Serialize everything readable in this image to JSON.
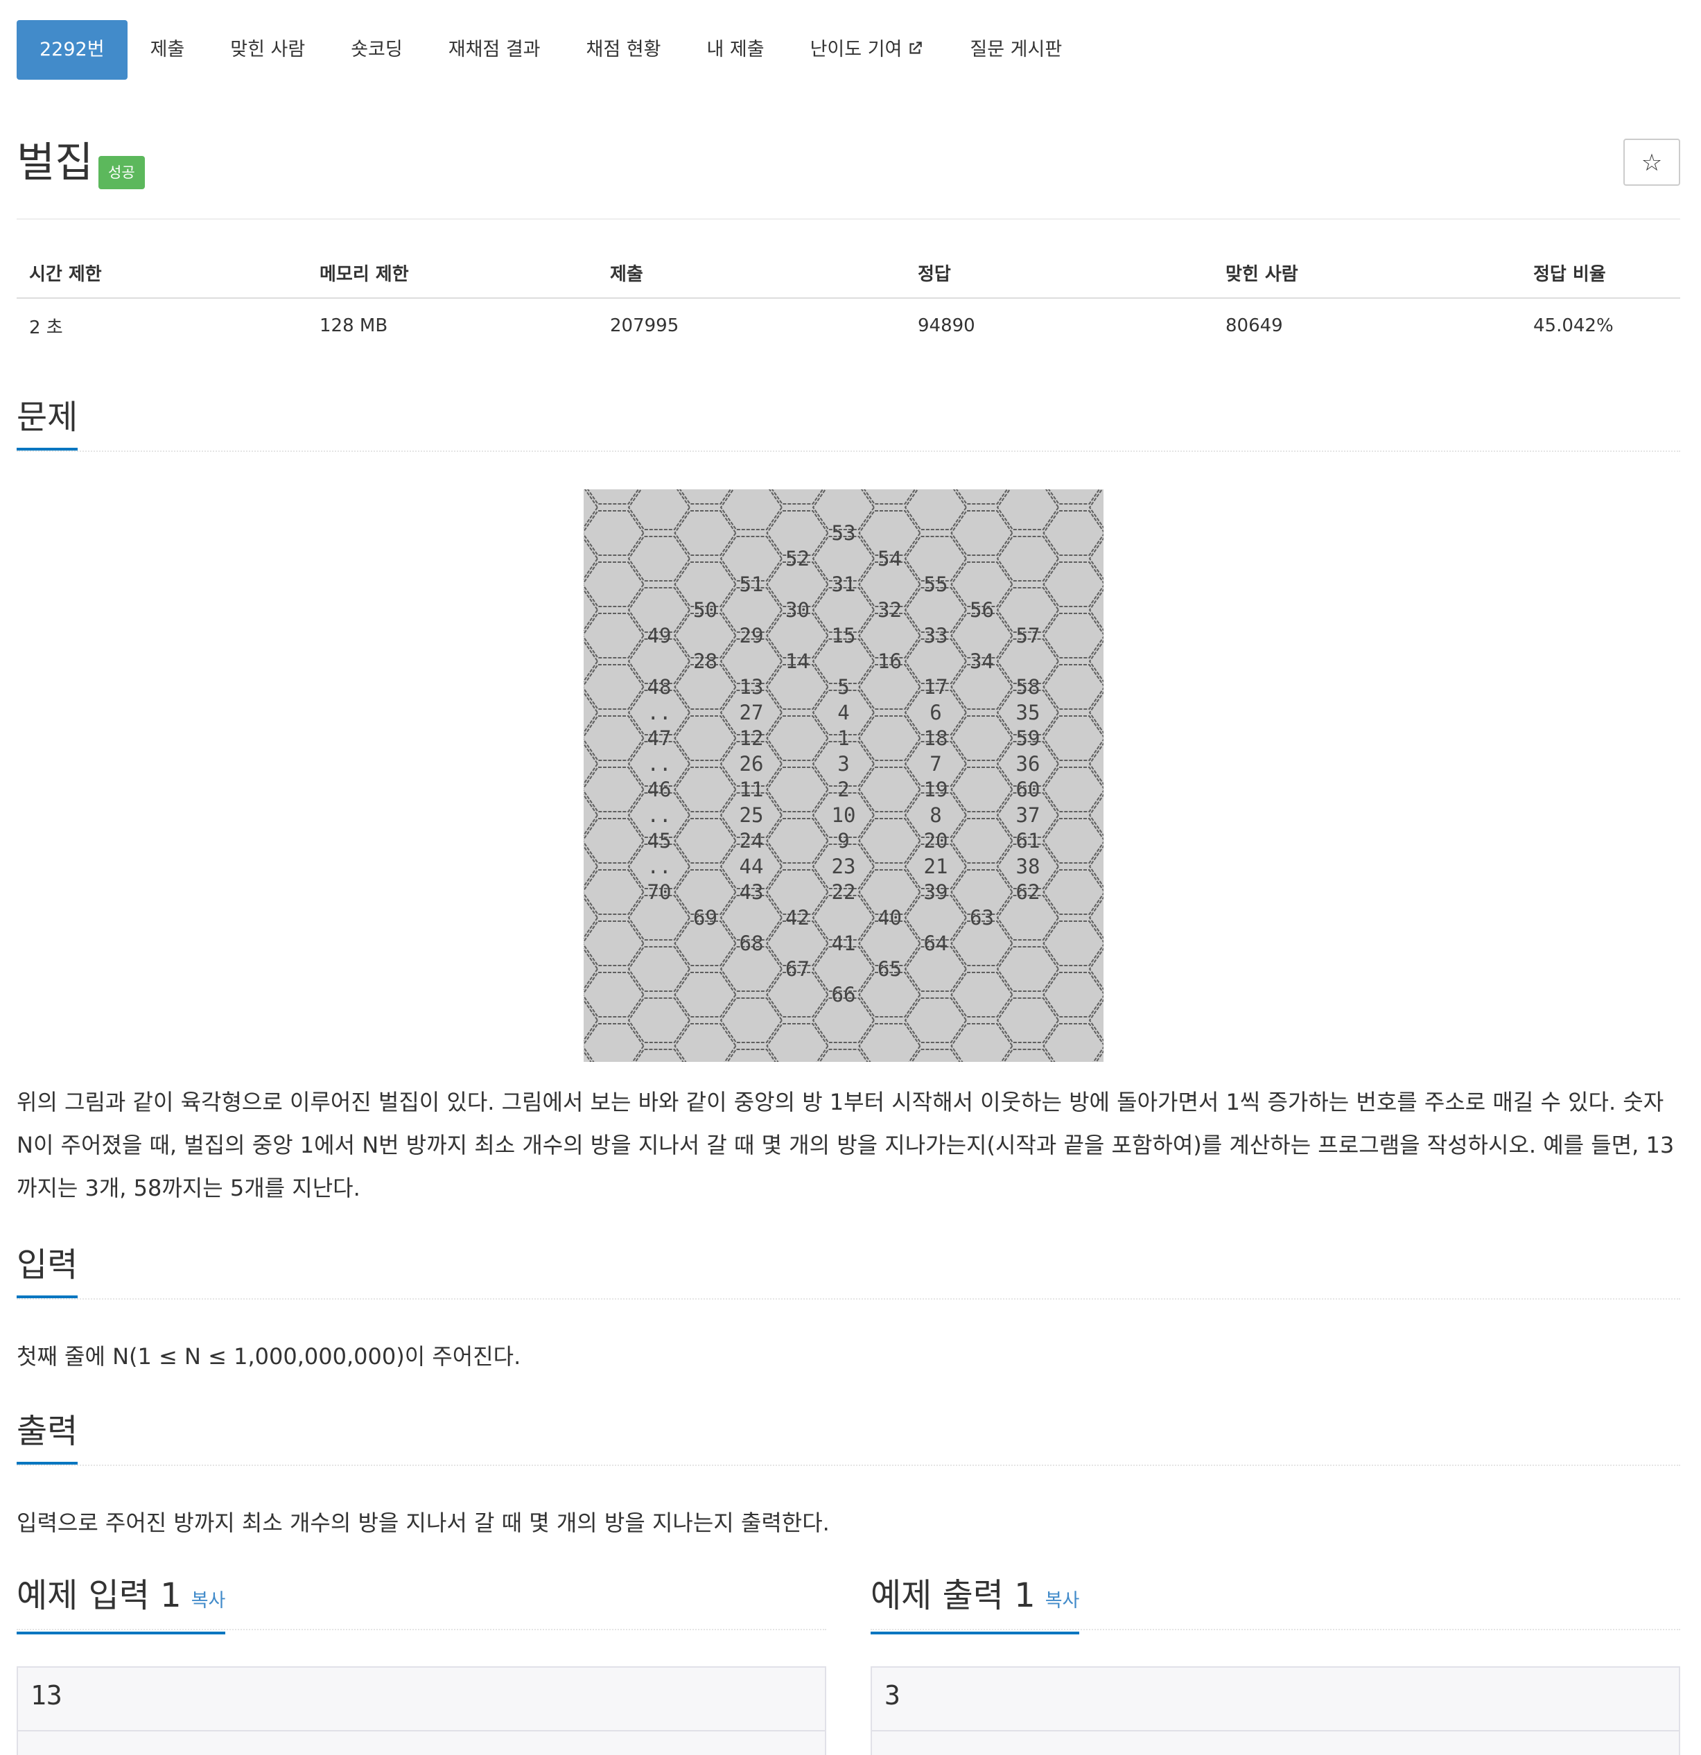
{
  "tabs": [
    {
      "label": "2292번",
      "active": true
    },
    {
      "label": "제출"
    },
    {
      "label": "맞힌 사람"
    },
    {
      "label": "숏코딩"
    },
    {
      "label": "재채점 결과"
    },
    {
      "label": "채점 현황"
    },
    {
      "label": "내 제출"
    },
    {
      "label": "난이도 기여",
      "icon": "external-link-icon"
    },
    {
      "label": "질문 게시판"
    }
  ],
  "problem": {
    "title": "벌집",
    "badge": "성공",
    "badge_color": "#5cb85c",
    "star_icon": "☆"
  },
  "info_table": {
    "headers": [
      "시간 제한",
      "메모리 제한",
      "제출",
      "정답",
      "맞힌 사람",
      "정답 비율"
    ],
    "values": [
      "2 초",
      "128 MB",
      "207995",
      "94890",
      "80649",
      "45.042%"
    ]
  },
  "sections": {
    "problem_heading": "문제",
    "problem_text": "위의 그림과 같이 육각형으로 이루어진 벌집이 있다. 그림에서 보는 바와 같이 중앙의 방 1부터 시작해서 이웃하는 방에 돌아가면서 1씩 증가하는 번호를 주소로 매길 수 있다. 숫자 N이 주어졌을 때, 벌집의 중앙 1에서 N번 방까지 최소 개수의 방을 지나서 갈 때 몇 개의 방을 지나가는지(시작과 끝을 포함하여)를 계산하는 프로그램을 작성하시오. 예를 들면, 13까지는 3개, 58까지는 5개를 지난다.",
    "input_heading": "입력",
    "input_text": "첫째 줄에 N(1 ≤ N ≤ 1,000,000,000)이 주어진다.",
    "output_heading": "출력",
    "output_text": "입력으로 주어진 방까지 최소 개수의 방을 지나서 갈 때 몇 개의 방을 지나는지 출력한다."
  },
  "samples": {
    "input_heading": "예제 입력 1",
    "output_heading": "예제 출력 1",
    "copy_label": "복사",
    "input_value": "13",
    "output_value": "3"
  },
  "honeycomb_labels": [
    [
      "53"
    ],
    [
      "52",
      "54"
    ],
    [
      "51",
      "31",
      "55"
    ],
    [
      "50",
      "30",
      "32",
      "56"
    ],
    [
      "49",
      "29",
      "15",
      "33",
      "57"
    ],
    [
      "28",
      "14",
      "16",
      "34"
    ],
    [
      "48",
      "13",
      "5",
      "17",
      "58"
    ],
    [
      "..",
      "27",
      "4",
      "6",
      "35"
    ],
    [
      "47",
      "12",
      "1",
      "18",
      "59"
    ],
    [
      "..",
      "26",
      "3",
      "7",
      "36"
    ],
    [
      "46",
      "11",
      "2",
      "19",
      "60"
    ],
    [
      "..",
      "25",
      "10",
      "8",
      "37"
    ],
    [
      "45",
      "24",
      "9",
      "20",
      "61"
    ],
    [
      "..",
      "44",
      "23",
      "21",
      "38"
    ],
    [
      "70",
      "43",
      "22",
      "39",
      "62"
    ],
    [
      "69",
      "42",
      "40",
      "63"
    ],
    [
      "68",
      "41",
      "64"
    ],
    [
      "67",
      "65"
    ],
    [
      "66"
    ]
  ],
  "colors": {
    "accent": "#428bca",
    "heading_underline": "#0076c0",
    "success": "#5cb85c"
  }
}
